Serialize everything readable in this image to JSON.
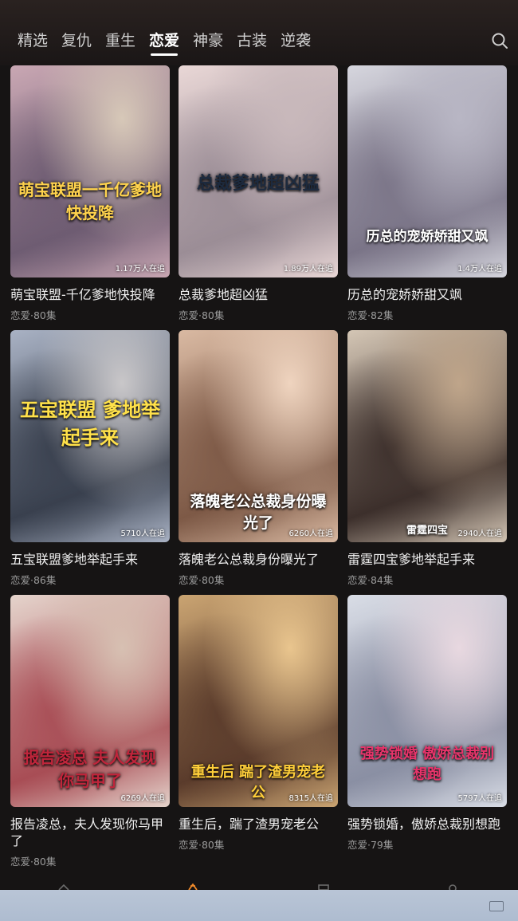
{
  "tabs": [
    {
      "label": "精选",
      "active": false
    },
    {
      "label": "复仇",
      "active": false
    },
    {
      "label": "重生",
      "active": false
    },
    {
      "label": "恋爱",
      "active": true
    },
    {
      "label": "神豪",
      "active": false
    },
    {
      "label": "古装",
      "active": false
    },
    {
      "label": "逆袭",
      "active": false
    }
  ],
  "search": {
    "icon": "search-icon"
  },
  "dramas": [
    {
      "title": "萌宝联盟-千亿爹地快投降",
      "meta": "恋爱·80集",
      "followers": "1.17万人在追",
      "poster_text": "萌宝联盟一千亿爹地快投降",
      "colors": [
        "#c9a7b3",
        "#6e5c72",
        "#d7c8b8"
      ]
    },
    {
      "title": "总裁爹地超凶猛",
      "meta": "恋爱·80集",
      "followers": "1.89万人在追",
      "poster_text": "总裁爹地超凶猛",
      "colors": [
        "#e9d7d6",
        "#9b8d96",
        "#c8b8bb"
      ]
    },
    {
      "title": "历总的宠娇娇甜又飒",
      "meta": "恋爱·82集",
      "followers": "1.4万人在追",
      "poster_text": "历总的宠娇娇甜又飒",
      "colors": [
        "#d6d6de",
        "#7a7487",
        "#b8b6c4"
      ]
    },
    {
      "title": "五宝联盟爹地举起手来",
      "meta": "恋爱·86集",
      "followers": "5710人在追",
      "poster_text": "五宝联盟 爹地举起手来",
      "colors": [
        "#a9b2c4",
        "#39404e",
        "#c9c7c9"
      ]
    },
    {
      "title": "落魄老公总裁身份曝光了",
      "meta": "恋爱·80集",
      "followers": "6260人在追",
      "poster_text": "落魄老公总裁身份曝光了",
      "colors": [
        "#d9b9a2",
        "#7d5946",
        "#efd4bf"
      ]
    },
    {
      "title": "雷霆四宝爹地举起手来",
      "meta": "恋爱·84集",
      "followers": "2940人在追",
      "poster_text": "雷霆四宝",
      "colors": [
        "#d4c6b5",
        "#3c2f2b",
        "#bfa58a"
      ]
    },
    {
      "title": "报告凌总，夫人发现你马甲了",
      "meta": "恋爱·80集",
      "followers": "6269人在追",
      "poster_text": "报告凌总 夫人发现你马甲了",
      "colors": [
        "#e5d4cc",
        "#a84d55",
        "#d7c0b2"
      ]
    },
    {
      "title": "重生后，踹了渣男宠老公",
      "meta": "恋爱·80集",
      "followers": "8315人在追",
      "poster_text": "重生后 踹了渣男宠老公",
      "colors": [
        "#caa472",
        "#5a3b2b",
        "#e9c58e"
      ]
    },
    {
      "title": "强势锁婚，傲娇总裁别想跑",
      "meta": "恋爱·79集",
      "followers": "5797人在追",
      "poster_text": "强势锁婚 傲娇总裁别想跑",
      "colors": [
        "#d9dde6",
        "#8a8fa3",
        "#e8d8e0"
      ]
    }
  ],
  "bottom_nav": [
    {
      "icon": "home-icon"
    },
    {
      "icon": "theater-icon"
    },
    {
      "icon": "favorites-icon"
    },
    {
      "icon": "profile-icon"
    }
  ],
  "system_bar": {
    "icon": "keyboard-icon"
  }
}
